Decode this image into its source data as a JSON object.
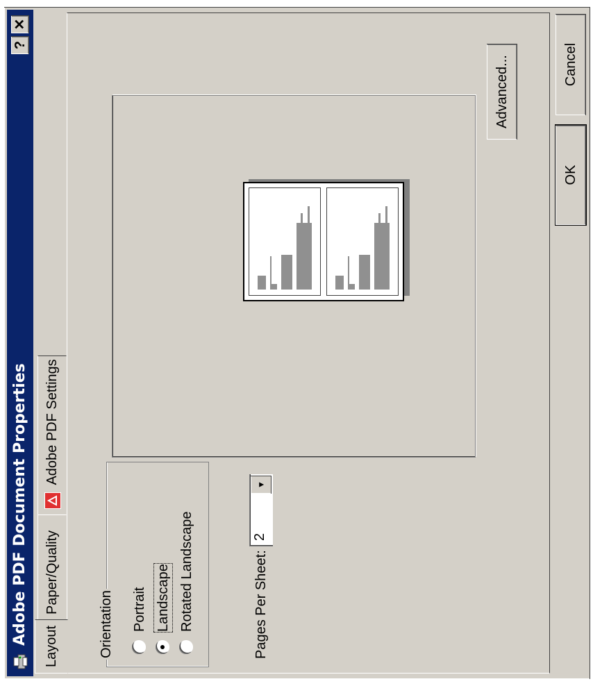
{
  "window": {
    "title": "Adobe PDF Document Properties",
    "help_label": "?",
    "close_label": "✕"
  },
  "tabs": [
    {
      "label": "Layout",
      "active": true
    },
    {
      "label": "Paper/Quality",
      "active": false
    },
    {
      "label": "Adobe PDF Settings",
      "active": false,
      "icon": "adobe-pdf-icon"
    }
  ],
  "orientation": {
    "group_title": "Orientation",
    "options": [
      {
        "label": "Portrait",
        "selected": false
      },
      {
        "label": "Landscape",
        "selected": true
      },
      {
        "label": "Rotated Landscape",
        "selected": false
      }
    ]
  },
  "pages_per_sheet": {
    "label": "Pages Per Sheet:",
    "value": "2"
  },
  "preview": {
    "orientation": "landscape",
    "pages_shown": 2
  },
  "buttons": {
    "advanced": "Advanced...",
    "ok": "OK",
    "cancel": "Cancel"
  },
  "colors": {
    "face": "#d4d0c8",
    "titlebar": "#0a246a",
    "shadow": "#808080"
  }
}
